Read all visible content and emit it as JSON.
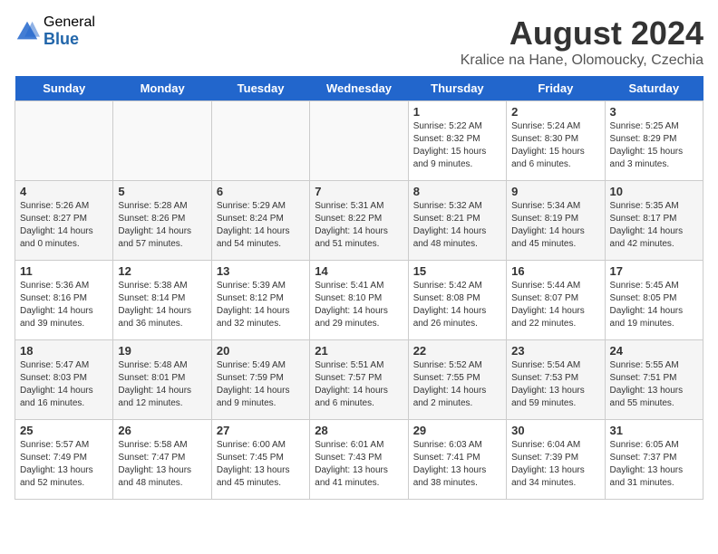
{
  "logo": {
    "general": "General",
    "blue": "Blue"
  },
  "header": {
    "month_year": "August 2024",
    "location": "Kralice na Hane, Olomoucky, Czechia"
  },
  "weekdays": [
    "Sunday",
    "Monday",
    "Tuesday",
    "Wednesday",
    "Thursday",
    "Friday",
    "Saturday"
  ],
  "weeks": [
    [
      {
        "day": "",
        "empty": true
      },
      {
        "day": "",
        "empty": true
      },
      {
        "day": "",
        "empty": true
      },
      {
        "day": "",
        "empty": true
      },
      {
        "day": "1",
        "sunrise": "5:22 AM",
        "sunset": "8:32 PM",
        "daylight": "15 hours and 9 minutes."
      },
      {
        "day": "2",
        "sunrise": "5:24 AM",
        "sunset": "8:30 PM",
        "daylight": "15 hours and 6 minutes."
      },
      {
        "day": "3",
        "sunrise": "5:25 AM",
        "sunset": "8:29 PM",
        "daylight": "15 hours and 3 minutes."
      }
    ],
    [
      {
        "day": "4",
        "sunrise": "5:26 AM",
        "sunset": "8:27 PM",
        "daylight": "14 hours and 0 minutes."
      },
      {
        "day": "5",
        "sunrise": "5:28 AM",
        "sunset": "8:26 PM",
        "daylight": "14 hours and 57 minutes."
      },
      {
        "day": "6",
        "sunrise": "5:29 AM",
        "sunset": "8:24 PM",
        "daylight": "14 hours and 54 minutes."
      },
      {
        "day": "7",
        "sunrise": "5:31 AM",
        "sunset": "8:22 PM",
        "daylight": "14 hours and 51 minutes."
      },
      {
        "day": "8",
        "sunrise": "5:32 AM",
        "sunset": "8:21 PM",
        "daylight": "14 hours and 48 minutes."
      },
      {
        "day": "9",
        "sunrise": "5:34 AM",
        "sunset": "8:19 PM",
        "daylight": "14 hours and 45 minutes."
      },
      {
        "day": "10",
        "sunrise": "5:35 AM",
        "sunset": "8:17 PM",
        "daylight": "14 hours and 42 minutes."
      }
    ],
    [
      {
        "day": "11",
        "sunrise": "5:36 AM",
        "sunset": "8:16 PM",
        "daylight": "14 hours and 39 minutes."
      },
      {
        "day": "12",
        "sunrise": "5:38 AM",
        "sunset": "8:14 PM",
        "daylight": "14 hours and 36 minutes."
      },
      {
        "day": "13",
        "sunrise": "5:39 AM",
        "sunset": "8:12 PM",
        "daylight": "14 hours and 32 minutes."
      },
      {
        "day": "14",
        "sunrise": "5:41 AM",
        "sunset": "8:10 PM",
        "daylight": "14 hours and 29 minutes."
      },
      {
        "day": "15",
        "sunrise": "5:42 AM",
        "sunset": "8:08 PM",
        "daylight": "14 hours and 26 minutes."
      },
      {
        "day": "16",
        "sunrise": "5:44 AM",
        "sunset": "8:07 PM",
        "daylight": "14 hours and 22 minutes."
      },
      {
        "day": "17",
        "sunrise": "5:45 AM",
        "sunset": "8:05 PM",
        "daylight": "14 hours and 19 minutes."
      }
    ],
    [
      {
        "day": "18",
        "sunrise": "5:47 AM",
        "sunset": "8:03 PM",
        "daylight": "14 hours and 16 minutes."
      },
      {
        "day": "19",
        "sunrise": "5:48 AM",
        "sunset": "8:01 PM",
        "daylight": "14 hours and 12 minutes."
      },
      {
        "day": "20",
        "sunrise": "5:49 AM",
        "sunset": "7:59 PM",
        "daylight": "14 hours and 9 minutes."
      },
      {
        "day": "21",
        "sunrise": "5:51 AM",
        "sunset": "7:57 PM",
        "daylight": "14 hours and 6 minutes."
      },
      {
        "day": "22",
        "sunrise": "5:52 AM",
        "sunset": "7:55 PM",
        "daylight": "14 hours and 2 minutes."
      },
      {
        "day": "23",
        "sunrise": "5:54 AM",
        "sunset": "7:53 PM",
        "daylight": "13 hours and 59 minutes."
      },
      {
        "day": "24",
        "sunrise": "5:55 AM",
        "sunset": "7:51 PM",
        "daylight": "13 hours and 55 minutes."
      }
    ],
    [
      {
        "day": "25",
        "sunrise": "5:57 AM",
        "sunset": "7:49 PM",
        "daylight": "13 hours and 52 minutes."
      },
      {
        "day": "26",
        "sunrise": "5:58 AM",
        "sunset": "7:47 PM",
        "daylight": "13 hours and 48 minutes."
      },
      {
        "day": "27",
        "sunrise": "6:00 AM",
        "sunset": "7:45 PM",
        "daylight": "13 hours and 45 minutes."
      },
      {
        "day": "28",
        "sunrise": "6:01 AM",
        "sunset": "7:43 PM",
        "daylight": "13 hours and 41 minutes."
      },
      {
        "day": "29",
        "sunrise": "6:03 AM",
        "sunset": "7:41 PM",
        "daylight": "13 hours and 38 minutes."
      },
      {
        "day": "30",
        "sunrise": "6:04 AM",
        "sunset": "7:39 PM",
        "daylight": "13 hours and 34 minutes."
      },
      {
        "day": "31",
        "sunrise": "6:05 AM",
        "sunset": "7:37 PM",
        "daylight": "13 hours and 31 minutes."
      }
    ]
  ]
}
